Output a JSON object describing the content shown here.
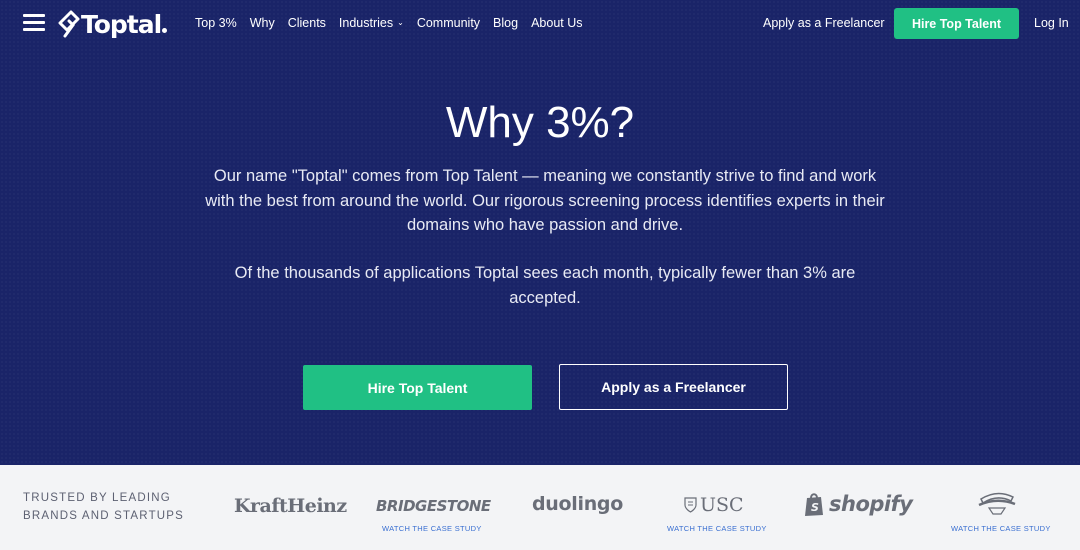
{
  "nav": {
    "logo_text": "Toptal",
    "links": [
      {
        "label": "Top 3%"
      },
      {
        "label": "Why"
      },
      {
        "label": "Clients"
      },
      {
        "label": "Industries",
        "dropdown": true
      },
      {
        "label": "Community"
      },
      {
        "label": "Blog"
      },
      {
        "label": "About Us"
      }
    ],
    "apply_label": "Apply as a Freelancer",
    "hire_label": "Hire Top Talent",
    "login_label": "Log In"
  },
  "hero": {
    "title": "Why 3%?",
    "paragraph1": "Our name \"Toptal\" comes from Top Talent — meaning we constantly strive to find and work with the best from around the world. Our rigorous screening process identifies experts in their domains who have passion and drive.",
    "paragraph2": "Of the thousands of applications Toptal sees each month, typically fewer than 3% are accepted.",
    "hire_button": "Hire Top Talent",
    "apply_button": "Apply as a Freelancer"
  },
  "trust": {
    "label": "Trusted by leading brands and startups",
    "brands": [
      {
        "name": "KraftHeinz"
      },
      {
        "name": "BRIDGESTONE",
        "case_study": "WATCH THE CASE STUDY"
      },
      {
        "name": "duolingo"
      },
      {
        "name": "USC",
        "case_study": "WATCH THE CASE STUDY"
      },
      {
        "name": "shopify"
      },
      {
        "name": "Cavaliers",
        "case_study": "WATCH THE CASE STUDY"
      }
    ]
  },
  "colors": {
    "hero_bg": "#1a2468",
    "accent_green": "#20c084",
    "trust_bg": "#f3f4f6",
    "link_blue": "#3a6fd1"
  }
}
